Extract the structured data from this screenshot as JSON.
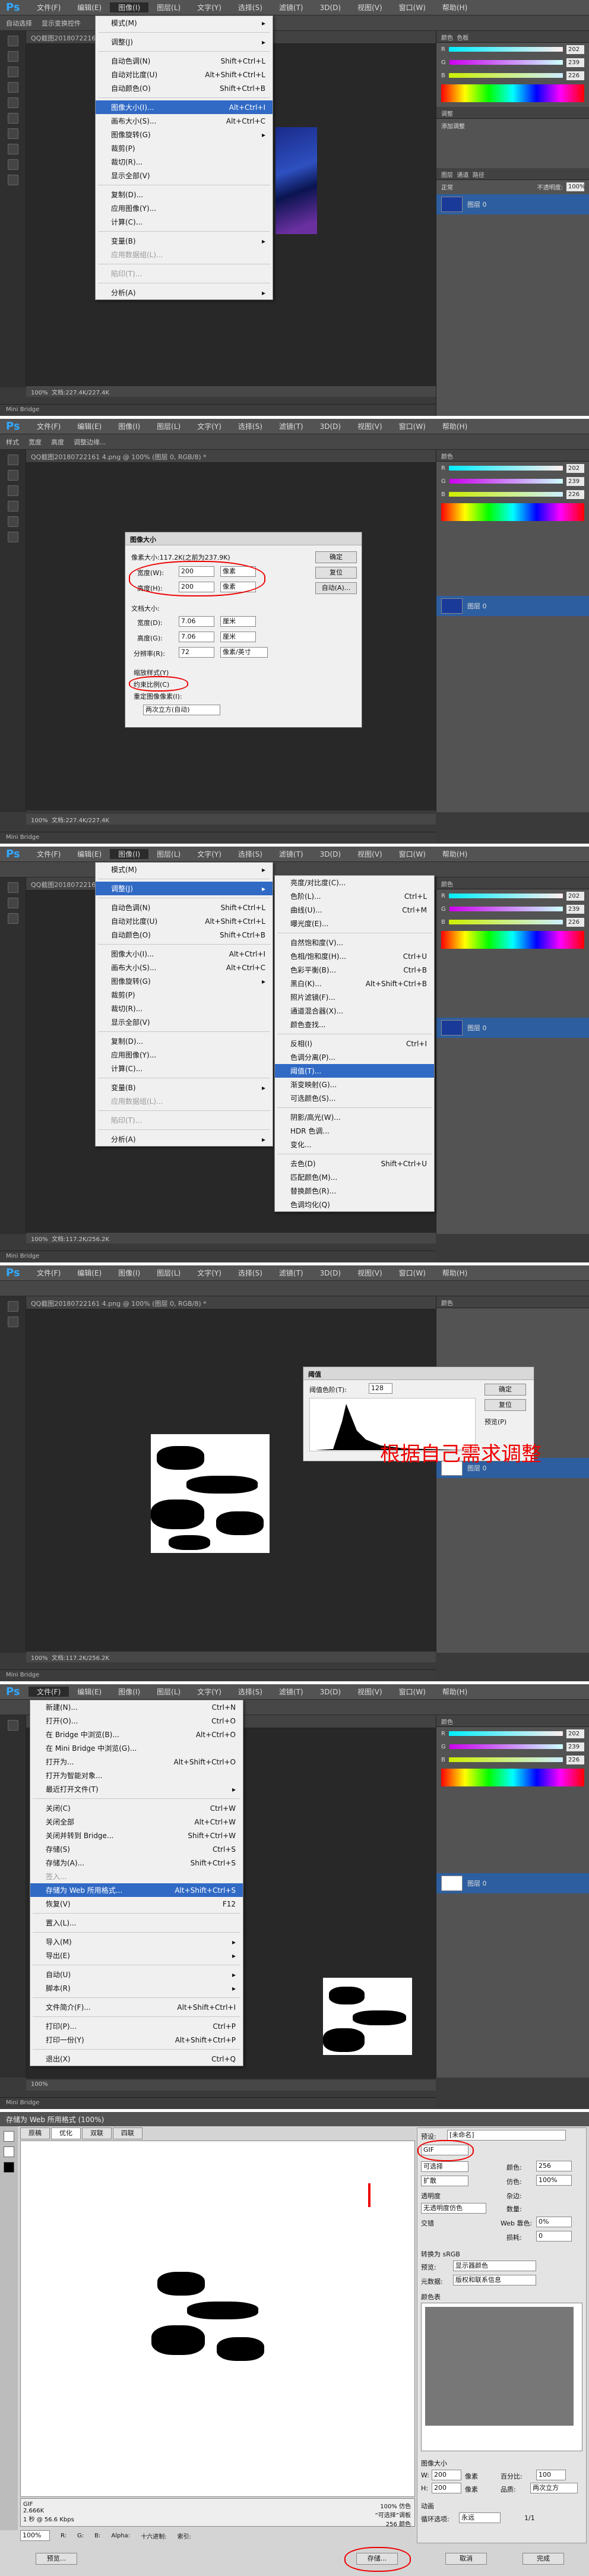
{
  "menu_bar": [
    "文件(F)",
    "编辑(E)",
    "图像(I)",
    "图层(L)",
    "文字(Y)",
    "选择(S)",
    "滤镜(T)",
    "3D(D)",
    "视图(V)",
    "窗口(W)",
    "帮助(H)"
  ],
  "doc_tab": "QQ截图20180722161...",
  "doc_tab_full": "QQ截图20180722161 4.png @ 100% (图层 0, RGB/8) *",
  "status_zoom": "100%",
  "status_doc1": "文档:227.4K/227.4K",
  "status_doc2": "文档:117.2K/256.2K",
  "mini_bridge": "Mini Bridge",
  "time_label": "时间轴",
  "options": {
    "auto": "自动选择",
    "layer": "图层",
    "show": "显示变换控件",
    "mode": "样式",
    "width": "宽度",
    "height": "高度",
    "adjust": "调整边缘..."
  },
  "color_panel": {
    "tab1": "颜色",
    "tab2": "色板",
    "r": "202",
    "g": "239",
    "b": "226"
  },
  "adjust_panel": {
    "tab": "调整",
    "title": "添加调整"
  },
  "layers_panel": {
    "tab1": "图层",
    "tab2": "通道",
    "tab3": "路径",
    "kind": "类型",
    "mode": "正常",
    "opacity_label": "不透明度:",
    "opacity": "100%",
    "lock": "锁定:",
    "fill_label": "填充:",
    "fill": "100%",
    "layer_name": "图层 0"
  },
  "image_menu": {
    "items": [
      {
        "label": "模式(M)",
        "sc": "",
        "arrow": true
      },
      {
        "sep": true
      },
      {
        "label": "调整(J)",
        "sc": "",
        "arrow": true
      },
      {
        "sep": true
      },
      {
        "label": "自动色调(N)",
        "sc": "Shift+Ctrl+L"
      },
      {
        "label": "自动对比度(U)",
        "sc": "Alt+Shift+Ctrl+L"
      },
      {
        "label": "自动颜色(O)",
        "sc": "Shift+Ctrl+B"
      },
      {
        "sep": true
      },
      {
        "label": "图像大小(I)...",
        "sc": "Alt+Ctrl+I"
      },
      {
        "label": "画布大小(S)...",
        "sc": "Alt+Ctrl+C"
      },
      {
        "label": "图像旋转(G)",
        "sc": "",
        "arrow": true
      },
      {
        "label": "裁剪(P)",
        "sc": ""
      },
      {
        "label": "裁切(R)...",
        "sc": ""
      },
      {
        "label": "显示全部(V)",
        "sc": ""
      },
      {
        "sep": true
      },
      {
        "label": "复制(D)...",
        "sc": ""
      },
      {
        "label": "应用图像(Y)...",
        "sc": ""
      },
      {
        "label": "计算(C)...",
        "sc": ""
      },
      {
        "sep": true
      },
      {
        "label": "变量(B)",
        "sc": "",
        "arrow": true
      },
      {
        "label": "应用数据组(L)...",
        "sc": "",
        "dis": true
      },
      {
        "sep": true
      },
      {
        "label": "陷印(T)...",
        "sc": "",
        "dis": true
      },
      {
        "sep": true
      },
      {
        "label": "分析(A)",
        "sc": "",
        "arrow": true
      }
    ]
  },
  "adjust_menu": {
    "items": [
      {
        "label": "亮度/对比度(C)...",
        "sc": ""
      },
      {
        "label": "色阶(L)...",
        "sc": "Ctrl+L"
      },
      {
        "label": "曲线(U)...",
        "sc": "Ctrl+M"
      },
      {
        "label": "曝光度(E)...",
        "sc": ""
      },
      {
        "sep": true
      },
      {
        "label": "自然饱和度(V)...",
        "sc": ""
      },
      {
        "label": "色相/饱和度(H)...",
        "sc": "Ctrl+U"
      },
      {
        "label": "色彩平衡(B)...",
        "sc": "Ctrl+B"
      },
      {
        "label": "黑白(K)...",
        "sc": "Alt+Shift+Ctrl+B"
      },
      {
        "label": "照片滤镜(F)...",
        "sc": ""
      },
      {
        "label": "通道混合器(X)...",
        "sc": ""
      },
      {
        "label": "颜色查找...",
        "sc": ""
      },
      {
        "sep": true
      },
      {
        "label": "反相(I)",
        "sc": "Ctrl+I"
      },
      {
        "label": "色调分离(P)...",
        "sc": ""
      },
      {
        "label": "阈值(T)...",
        "sc": ""
      },
      {
        "label": "渐变映射(G)...",
        "sc": ""
      },
      {
        "label": "可选颜色(S)...",
        "sc": ""
      },
      {
        "sep": true
      },
      {
        "label": "阴影/高光(W)...",
        "sc": ""
      },
      {
        "label": "HDR 色调...",
        "sc": ""
      },
      {
        "label": "变化...",
        "sc": ""
      },
      {
        "sep": true
      },
      {
        "label": "去色(D)",
        "sc": "Shift+Ctrl+U"
      },
      {
        "label": "匹配颜色(M)...",
        "sc": ""
      },
      {
        "label": "替换颜色(R)...",
        "sc": ""
      },
      {
        "label": "色调均化(Q)",
        "sc": ""
      }
    ]
  },
  "file_menu": {
    "items": [
      {
        "label": "新建(N)...",
        "sc": "Ctrl+N"
      },
      {
        "label": "打开(O)...",
        "sc": "Ctrl+O"
      },
      {
        "label": "在 Bridge 中浏览(B)...",
        "sc": "Alt+Ctrl+O"
      },
      {
        "label": "在 Mini Bridge 中浏览(G)...",
        "sc": ""
      },
      {
        "label": "打开为...",
        "sc": "Alt+Shift+Ctrl+O"
      },
      {
        "label": "打开为智能对象...",
        "sc": ""
      },
      {
        "label": "最近打开文件(T)",
        "sc": "",
        "arrow": true
      },
      {
        "sep": true
      },
      {
        "label": "关闭(C)",
        "sc": "Ctrl+W"
      },
      {
        "label": "关闭全部",
        "sc": "Alt+Ctrl+W"
      },
      {
        "label": "关闭并转到 Bridge...",
        "sc": "Shift+Ctrl+W"
      },
      {
        "label": "存储(S)",
        "sc": "Ctrl+S"
      },
      {
        "label": "存储为(A)...",
        "sc": "Shift+Ctrl+S"
      },
      {
        "label": "签入...",
        "sc": "",
        "dis": true
      },
      {
        "label": "存储为 Web 所用格式...",
        "sc": "Alt+Shift+Ctrl+S"
      },
      {
        "label": "恢复(V)",
        "sc": "F12"
      },
      {
        "sep": true
      },
      {
        "label": "置入(L)...",
        "sc": ""
      },
      {
        "sep": true
      },
      {
        "label": "导入(M)",
        "sc": "",
        "arrow": true
      },
      {
        "label": "导出(E)",
        "sc": "",
        "arrow": true
      },
      {
        "sep": true
      },
      {
        "label": "自动(U)",
        "sc": "",
        "arrow": true
      },
      {
        "label": "脚本(R)",
        "sc": "",
        "arrow": true
      },
      {
        "sep": true
      },
      {
        "label": "文件简介(F)...",
        "sc": "Alt+Shift+Ctrl+I"
      },
      {
        "sep": true
      },
      {
        "label": "打印(P)...",
        "sc": "Ctrl+P"
      },
      {
        "label": "打印一份(Y)",
        "sc": "Alt+Shift+Ctrl+P"
      },
      {
        "sep": true
      },
      {
        "label": "退出(X)",
        "sc": "Ctrl+Q"
      }
    ]
  },
  "image_size_dialog": {
    "title": "图像大小",
    "pixel_dims": "像素大小:117.2K(之前为237.9K)",
    "width_label": "宽度(W):",
    "width": "200",
    "height_label": "高度(H):",
    "height": "200",
    "unit": "像素",
    "doc_size": "文档大小:",
    "doc_w_label": "宽度(D):",
    "doc_w": "7.06",
    "doc_h_label": "高度(G):",
    "doc_h": "7.06",
    "cm": "厘米",
    "res_label": "分辨率(R):",
    "res": "72",
    "res_unit": "像素/英寸",
    "scale_styles": "缩放样式(Y)",
    "constrain": "约束比例(C)",
    "resample": "重定图像像素(I):",
    "resample_val": "两次立方(自动)",
    "ok": "确定",
    "reset": "复位",
    "auto": "自动(A)..."
  },
  "threshold_dialog": {
    "title": "阈值",
    "label": "阈值色阶(T):",
    "value": "128",
    "ok": "确定",
    "reset": "复位",
    "preview": "预览(P)"
  },
  "annotation": "根据自己需求调整",
  "sfw": {
    "title": "存储为 Web 所用格式 (100%)",
    "tabs": [
      "原稿",
      "优化",
      "双联",
      "四联"
    ],
    "preset_label": "预设:",
    "preset": "[未命名]",
    "format": "GIF",
    "reduction": "可选择",
    "dither_algo": "扩散",
    "transparency": "透明度",
    "matte_label": "杂边:",
    "no_dither": "无透明度仿色",
    "colors_label": "颜色:",
    "colors": "256",
    "dither_label": "仿色:",
    "dither": "100%",
    "amount_label": "数量:",
    "web_snap_label": "Web 靠色:",
    "web_snap": "0%",
    "lossy_label": "损耗:",
    "lossy": "0",
    "interlaced": "交错",
    "convert_srgb": "转换为 sRGB",
    "preview_label": "预览:",
    "preview_val": "显示器颜色",
    "metadata_label": "元数据:",
    "metadata": "版权和联系信息",
    "color_table": "颜色表",
    "image_size": "图像大小",
    "w_label": "W:",
    "w": "200",
    "h_label": "H:",
    "h": "200",
    "px": "像素",
    "percent_label": "百分比:",
    "percent": "100",
    "quality_label": "品质:",
    "quality": "两次立方",
    "anim": "动画",
    "loop_label": "循环选项:",
    "loop": "永远",
    "page": "1/1",
    "info_format": "GIF",
    "info_size": "2.666K",
    "info_time": "1 秒 @ 56.6 Kbps",
    "info_pct": "100% 仿色",
    "info_pal": "“可选择”调板",
    "info_colors": "256 颜色",
    "zoom": "100%",
    "r": "R:",
    "g": "G:",
    "b": "B:",
    "alpha": "Alpha:",
    "hex": "十六进制:",
    "index": "索引:",
    "preview_btn": "预览...",
    "save": "存储...",
    "cancel": "取消",
    "done": "完成"
  },
  "colors": {
    "accent": "#316ac5",
    "red": "#e00000",
    "bg": "#3a3a3a"
  }
}
